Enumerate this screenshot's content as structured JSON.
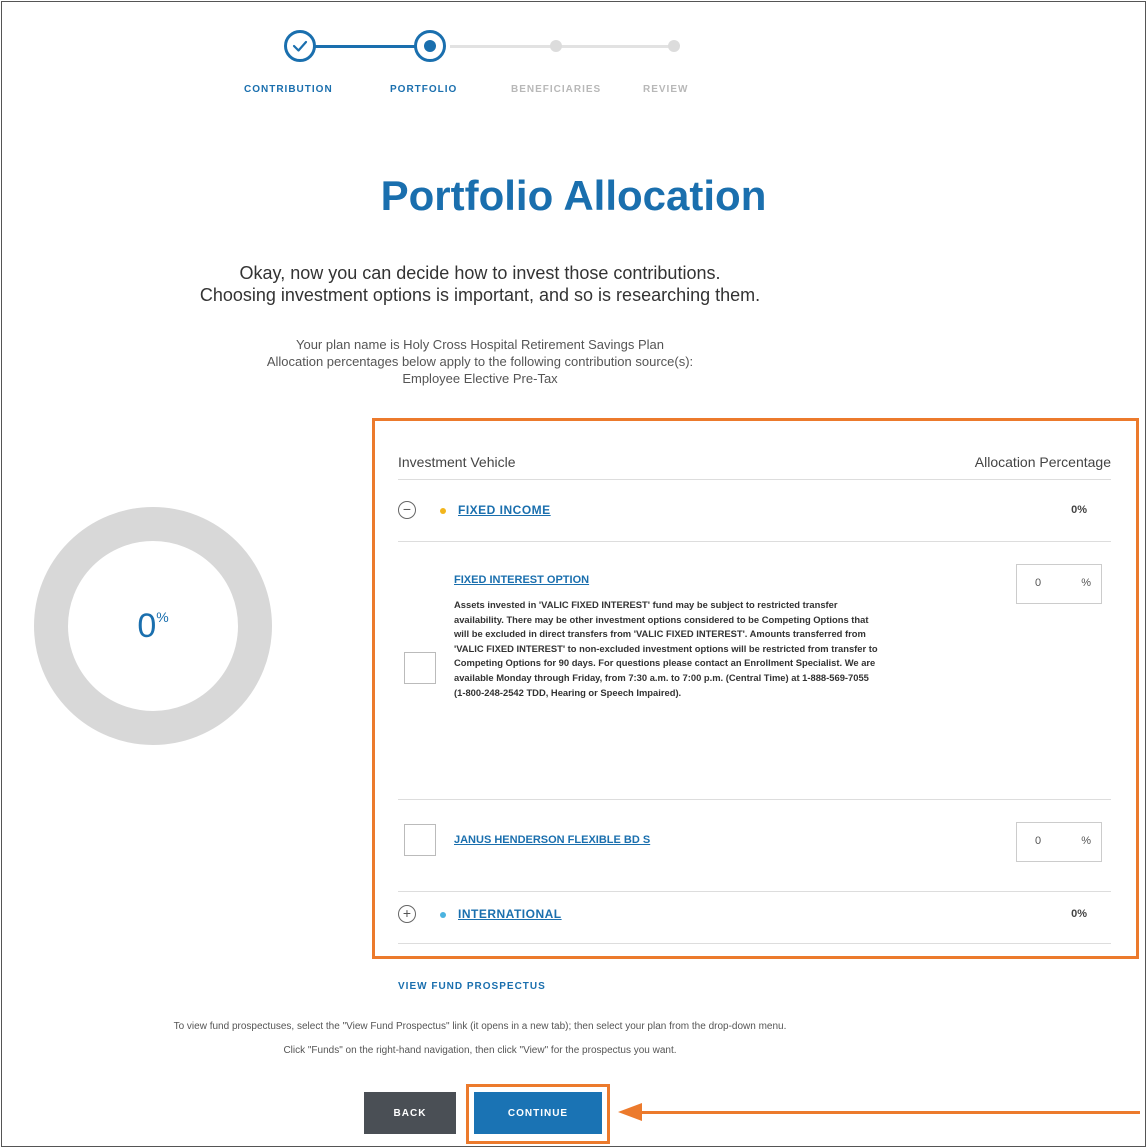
{
  "stepper": {
    "steps": [
      {
        "label": "CONTRIBUTION",
        "state": "complete"
      },
      {
        "label": "PORTFOLIO",
        "state": "current"
      },
      {
        "label": "BENEFICIARIES",
        "state": "pending"
      },
      {
        "label": "REVIEW",
        "state": "pending"
      }
    ]
  },
  "page": {
    "title": "Portfolio Allocation",
    "intro_line1": "Okay, now you can decide how to invest those contributions.",
    "intro_line2": "Choosing investment options is important, and so is researching them.",
    "plan_line1": "Your plan name is Holy Cross Hospital Retirement Savings Plan",
    "plan_line2": "Allocation percentages below apply to the following contribution source(s):",
    "plan_line3": "Employee Elective Pre-Tax"
  },
  "donut": {
    "value": "0",
    "unit": "%"
  },
  "table": {
    "col_vehicle": "Investment Vehicle",
    "col_allocation": "Allocation Percentage",
    "fixed_income": {
      "label": "FIXED INCOME",
      "percent": "0%",
      "toggle": "−",
      "bullet_color": "#f2b51c"
    },
    "fixed_interest": {
      "name": "FIXED INTEREST OPTION",
      "value": "0",
      "unit": "%",
      "description": "Assets invested in 'VALIC FIXED INTEREST' fund may be subject to restricted transfer availability. There may be other investment options considered to be Competing Options that will be excluded in direct transfers from 'VALIC FIXED INTEREST'. Amounts transferred from 'VALIC FIXED INTEREST' to non-excluded investment options will be restricted from transfer to Competing Options for 90 days. For questions please contact an Enrollment Specialist. We are available Monday through Friday, from 7:30 a.m. to 7:00 p.m. (Central Time) at 1-888-569-7055 (1-800-248-2542 TDD, Hearing or Speech Impaired)."
    },
    "janus": {
      "name": "JANUS HENDERSON FLEXIBLE BD S",
      "value": "0",
      "unit": "%"
    },
    "international": {
      "label": "INTERNATIONAL",
      "percent": "0%",
      "toggle": "+",
      "bullet_color": "#4bb3e0"
    }
  },
  "prospectus_link": "VIEW FUND PROSPECTUS",
  "instructions": {
    "line1": "To view fund prospectuses, select the \"View Fund Prospectus\" link (it opens in a new tab); then select your plan from the drop-down menu.",
    "line2": "Click \"Funds\" on the right-hand navigation, then click \"View\" for the prospectus you want."
  },
  "buttons": {
    "back": "BACK",
    "continue": "CONTINUE"
  },
  "colors": {
    "accent": "#1a6fae",
    "highlight": "#ec7a2c",
    "back_button": "#4a4f55"
  }
}
